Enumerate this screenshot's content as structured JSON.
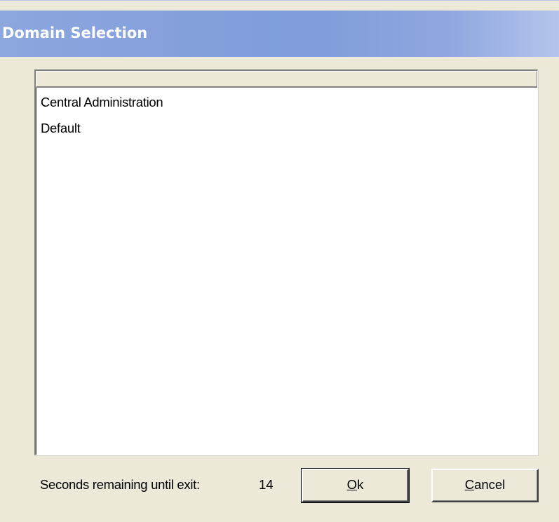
{
  "window": {
    "title": "Domain Selection"
  },
  "list": {
    "header_label": "",
    "items": [
      {
        "label": "Central Administration"
      },
      {
        "label": "Default"
      }
    ]
  },
  "status": {
    "label": "Seconds remaining until exit:",
    "seconds": "14"
  },
  "buttons": {
    "ok": {
      "mnemonic": "O",
      "rest": "k"
    },
    "cancel": {
      "mnemonic": "C",
      "rest": "ancel"
    }
  },
  "colors": {
    "titlebar": "#7F9CDB",
    "face": "#ECE9D8",
    "list_background": "#FFFFFF"
  }
}
